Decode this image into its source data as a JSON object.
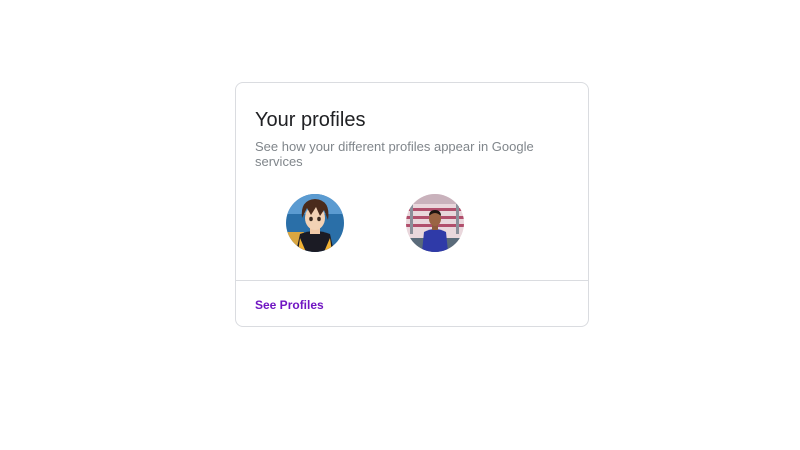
{
  "card": {
    "title": "Your profiles",
    "subtitle": "See how your different profiles appear in Google services",
    "link_label": "See Profiles"
  },
  "profiles": [
    {
      "avatar": "anime-character-avatar"
    },
    {
      "avatar": "person-photo-avatar"
    }
  ],
  "colors": {
    "link": "#7015c2",
    "border": "#dadce0",
    "subtitle": "#80868b"
  }
}
